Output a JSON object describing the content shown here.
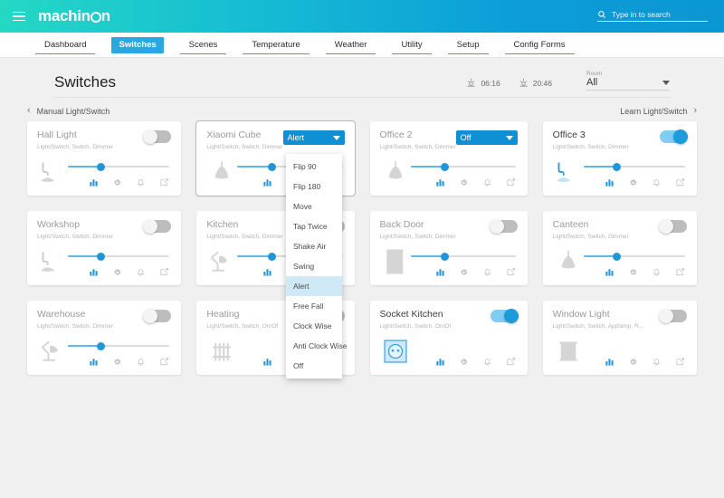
{
  "topbar": {
    "menu_icon": "hamburger-icon",
    "brand": "machin",
    "brand_tail": "n",
    "search": {
      "placeholder": "Type in to search",
      "value": "",
      "icon": "search-icon"
    }
  },
  "nav": {
    "items": [
      {
        "label": "Dashboard",
        "active": false
      },
      {
        "label": "Switches",
        "active": true
      },
      {
        "label": "Scenes",
        "active": false
      },
      {
        "label": "Temperature",
        "active": false
      },
      {
        "label": "Weather",
        "active": false
      },
      {
        "label": "Utility",
        "active": false
      },
      {
        "label": "Setup",
        "active": false
      },
      {
        "label": "Config Forms",
        "active": false
      }
    ]
  },
  "page": {
    "title": "Switches",
    "sunrise": {
      "icon": "sunrise-icon",
      "time": "06:16"
    },
    "sunset": {
      "icon": "sunset-icon",
      "time": "20:46"
    },
    "room_filter": {
      "label": "Room",
      "value": "All",
      "icon": "chevron-down-icon"
    },
    "back_link": "Manual Light/Switch",
    "learn_link": "Learn Light/Switch"
  },
  "actions": {
    "chart": "bar-chart-icon",
    "gear": "gear-icon",
    "notify": "bell-icon",
    "edit": "edit-icon"
  },
  "dropdown": {
    "open": true,
    "selected": "Alert",
    "options": [
      "Flip 90",
      "Flip 180",
      "Move",
      "Tap Twice",
      "Shake Air",
      "Swing",
      "Alert",
      "Free Fall",
      "Clock Wise",
      "Anti Clock Wise",
      "Off"
    ]
  },
  "cards": [
    {
      "name": "Hall Light",
      "sub": "Light/Switch, Switch, Dimmer",
      "control": "toggle",
      "state": "off",
      "icon": "wall-lamp-icon",
      "slider": true,
      "slider_pct": 32,
      "on": false
    },
    {
      "name": "Xiaomi Cube",
      "sub": "Light/Switch, Switch, Dimmer",
      "control": "select",
      "select_value": "Alert",
      "icon": "pendant-lamp-icon",
      "slider": true,
      "slider_pct": 32,
      "on": false,
      "selected_card": true
    },
    {
      "name": "Office 2",
      "sub": "Light/Switch, Switch, Dimmer",
      "control": "select",
      "select_value": "Off",
      "icon": "pendant-lamp-icon",
      "slider": true,
      "slider_pct": 32,
      "on": false
    },
    {
      "name": "Office 3",
      "sub": "Light/Switch, Switch, Dimmer",
      "control": "toggle",
      "state": "on",
      "icon": "wall-lamp-icon",
      "slider": true,
      "slider_pct": 32,
      "on": true
    },
    {
      "name": "Workshop",
      "sub": "Light/Switch, Switch, Dimmer",
      "control": "toggle",
      "state": "off",
      "icon": "wall-lamp-icon",
      "slider": true,
      "slider_pct": 32,
      "on": false
    },
    {
      "name": "Kitchen",
      "sub": "Light/Switch, Switch, Dimmer",
      "control": "toggle",
      "state": "off",
      "icon": "desk-lamp-icon",
      "slider": true,
      "slider_pct": 32,
      "on": false
    },
    {
      "name": "Back Door",
      "sub": "Light/Switch, Switch, Dimmer",
      "control": "toggle",
      "state": "off",
      "icon": "door-icon",
      "slider": true,
      "slider_pct": 32,
      "on": false
    },
    {
      "name": "Canteen",
      "sub": "Light/Switch, Switch, Dimmer",
      "control": "toggle",
      "state": "off",
      "icon": "pendant-lamp-icon",
      "slider": true,
      "slider_pct": 32,
      "on": false
    },
    {
      "name": "Warehouse",
      "sub": "Light/Switch, Switch, Dimmer",
      "control": "toggle",
      "state": "off",
      "icon": "desk-lamp-icon",
      "slider": true,
      "slider_pct": 32,
      "on": false
    },
    {
      "name": "Heating",
      "sub": "Light/Switch, Switch, On/Of",
      "control": "toggle",
      "state": "off",
      "icon": "radiator-icon",
      "slider": false,
      "on": false
    },
    {
      "name": "Socket Kitchen",
      "sub": "Light/Switch, Switch, On/Of",
      "control": "toggle",
      "state": "on",
      "icon": "power-socket-icon",
      "slider": false,
      "on": true
    },
    {
      "name": "Window Light",
      "sub": "Light/Switch, Switch, Applamp, R...",
      "control": "toggle",
      "state": "off",
      "icon": "window-icon",
      "slider": false,
      "on": false
    }
  ],
  "colors": {
    "accent": "#29a8e0",
    "brand_gradient_start": "#24d8c4",
    "brand_gradient_end": "#0b96d4",
    "toggle_on": "#1e9bdb",
    "toggle_off": "#bdbdbd",
    "page_bg": "#f0f0f0"
  }
}
